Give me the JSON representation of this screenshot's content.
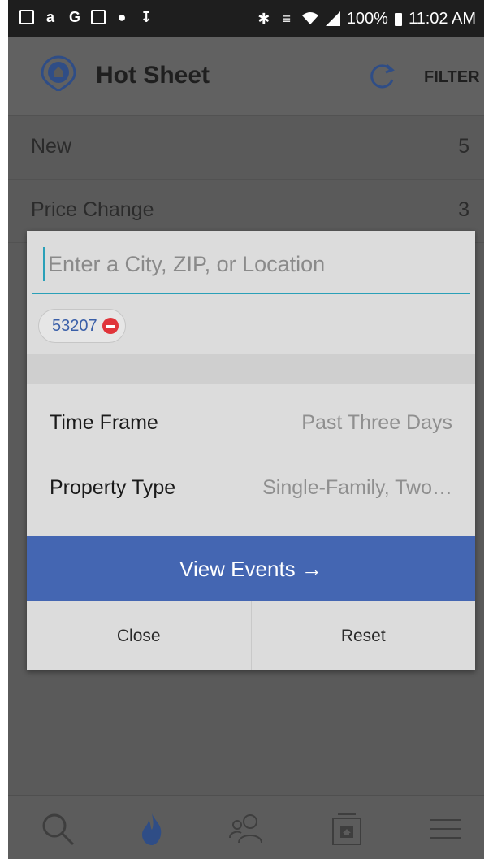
{
  "status_bar": {
    "battery": "100%",
    "time": "11:02 AM"
  },
  "app_bar": {
    "title": "Hot Sheet",
    "filter_label": "FILTER"
  },
  "background_list": [
    {
      "label": "New",
      "count": "5"
    },
    {
      "label": "Price Change",
      "count": "3"
    }
  ],
  "modal": {
    "search": {
      "placeholder": "Enter a City, ZIP, or Location",
      "value": ""
    },
    "chip": {
      "label": "53207"
    },
    "options": [
      {
        "label": "Time Frame",
        "value": "Past Three Days"
      },
      {
        "label": "Property Type",
        "value": "Single-Family, Two…"
      }
    ],
    "view_events_label": "View Events →",
    "close_label": "Close",
    "reset_label": "Reset"
  },
  "bottom_nav": {
    "items": [
      "search-icon",
      "flame-icon",
      "people-icon",
      "home-listing-icon",
      "menu-icon"
    ],
    "active": "flame-icon"
  },
  "colors": {
    "accent_blue": "#4466b2",
    "focus_teal": "#2aa0b8",
    "chip_text": "#3a5fa8",
    "remove_red": "#e0343a"
  }
}
